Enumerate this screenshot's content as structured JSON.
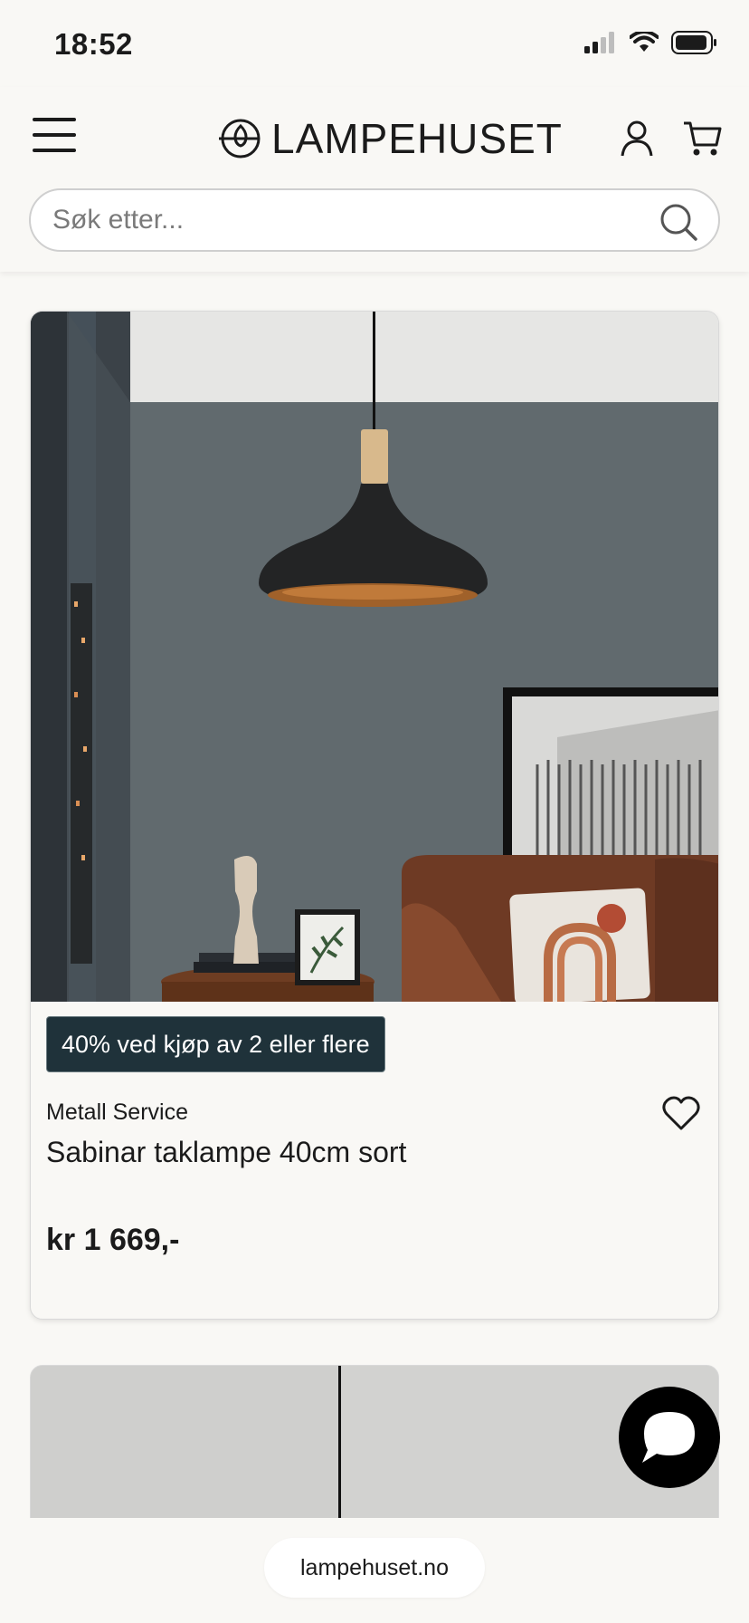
{
  "status_bar": {
    "time": "18:52"
  },
  "header": {
    "brand": "LAMPEHUSET",
    "search_placeholder": "Søk etter..."
  },
  "product": {
    "badge": "40% ved kjøp av 2 eller flere",
    "brand": "Metall Service",
    "name": "Sabinar taklampe 40cm sort",
    "price": "kr 1 669,-"
  },
  "browser": {
    "url": "lampehuset.no"
  },
  "icons": {
    "menu": "hamburger-menu-icon",
    "account": "user-icon",
    "cart": "cart-icon",
    "search": "search-icon",
    "wishlist": "heart-icon",
    "chat": "chat-bubble-icon"
  },
  "colors": {
    "background": "#f9f8f5",
    "badge": "#1f323a",
    "text": "#1b1b1b"
  }
}
